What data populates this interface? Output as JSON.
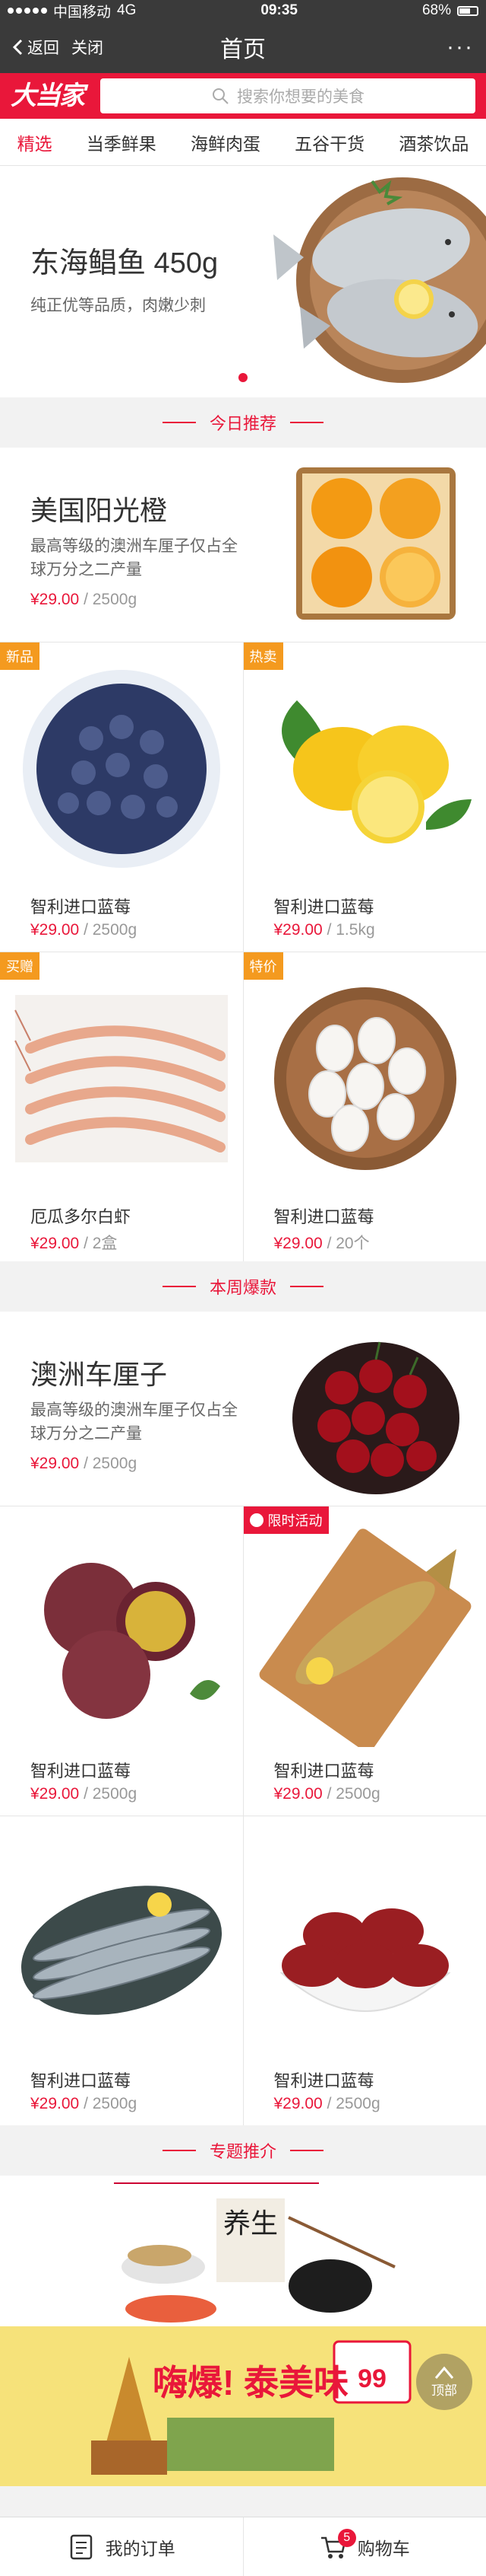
{
  "status": {
    "carrier": "中国移动",
    "network": "4G",
    "time": "09:35",
    "battery": "68%"
  },
  "nav": {
    "back": "返回",
    "close": "关闭",
    "title": "首页",
    "more": "···"
  },
  "brand": {
    "logo": "大当家",
    "search_placeholder": "搜索你想要的美食"
  },
  "tabs": [
    "精选",
    "当季鲜果",
    "海鲜肉蛋",
    "五谷干货",
    "酒茶饮品"
  ],
  "active_tab": "精选",
  "hero": {
    "title": "东海鲳鱼 450g",
    "subtitle": "纯正优等品质，肉嫩少刺"
  },
  "sections": {
    "today": "今日推荐",
    "weekly": "本周爆款",
    "topic": "专题推介"
  },
  "feature1": {
    "title": "美国阳光橙",
    "desc": "最高等级的澳洲车厘子仅占全球万分之二产量",
    "price": "¥29.00",
    "unit": "/ 2500g"
  },
  "grid1": [
    {
      "badge": "新品",
      "name": "智利进口蓝莓",
      "price": "¥29.00",
      "unit": "/ 2500g",
      "img": "blueberry"
    },
    {
      "badge": "热卖",
      "name": "智利进口蓝莓",
      "price": "¥29.00",
      "unit": "/ 1.5kg",
      "img": "lemon"
    },
    {
      "badge": "买赠",
      "name": "厄瓜多尔白虾",
      "price": "¥29.00",
      "unit": "/ 2盒",
      "img": "shrimp"
    },
    {
      "badge": "特价",
      "name": "智利进口蓝莓",
      "price": "¥29.00",
      "unit": "/ 20个",
      "img": "eggs"
    }
  ],
  "feature2": {
    "title": "澳洲车厘子",
    "desc": "最高等级的澳洲车厘子仅占全球万分之二产量",
    "price": "¥29.00",
    "unit": "/ 2500g"
  },
  "grid2": [
    {
      "badge": "",
      "name": "智利进口蓝莓",
      "price": "¥29.00",
      "unit": "/ 2500g",
      "img": "passion"
    },
    {
      "badge": "限时活动",
      "name": "智利进口蓝莓",
      "price": "¥29.00",
      "unit": "/ 2500g",
      "img": "fish"
    },
    {
      "badge": "",
      "name": "智利进口蓝莓",
      "price": "¥29.00",
      "unit": "/ 2500g",
      "img": "saury"
    },
    {
      "badge": "",
      "name": "智利进口蓝莓",
      "price": "¥29.00",
      "unit": "/ 2500g",
      "img": "dates"
    }
  ],
  "banner1": {
    "text": "养生"
  },
  "banner2": {
    "text": "嗨爆! 泰美味",
    "tag": "99"
  },
  "totop": "顶部",
  "bottom": {
    "orders": "我的订单",
    "cart": "购物车",
    "cart_count": "5"
  },
  "colors": {
    "accent": "#e9173a",
    "badge_orange": "#f49a1f",
    "bar_dark": "#3a3a3a"
  }
}
